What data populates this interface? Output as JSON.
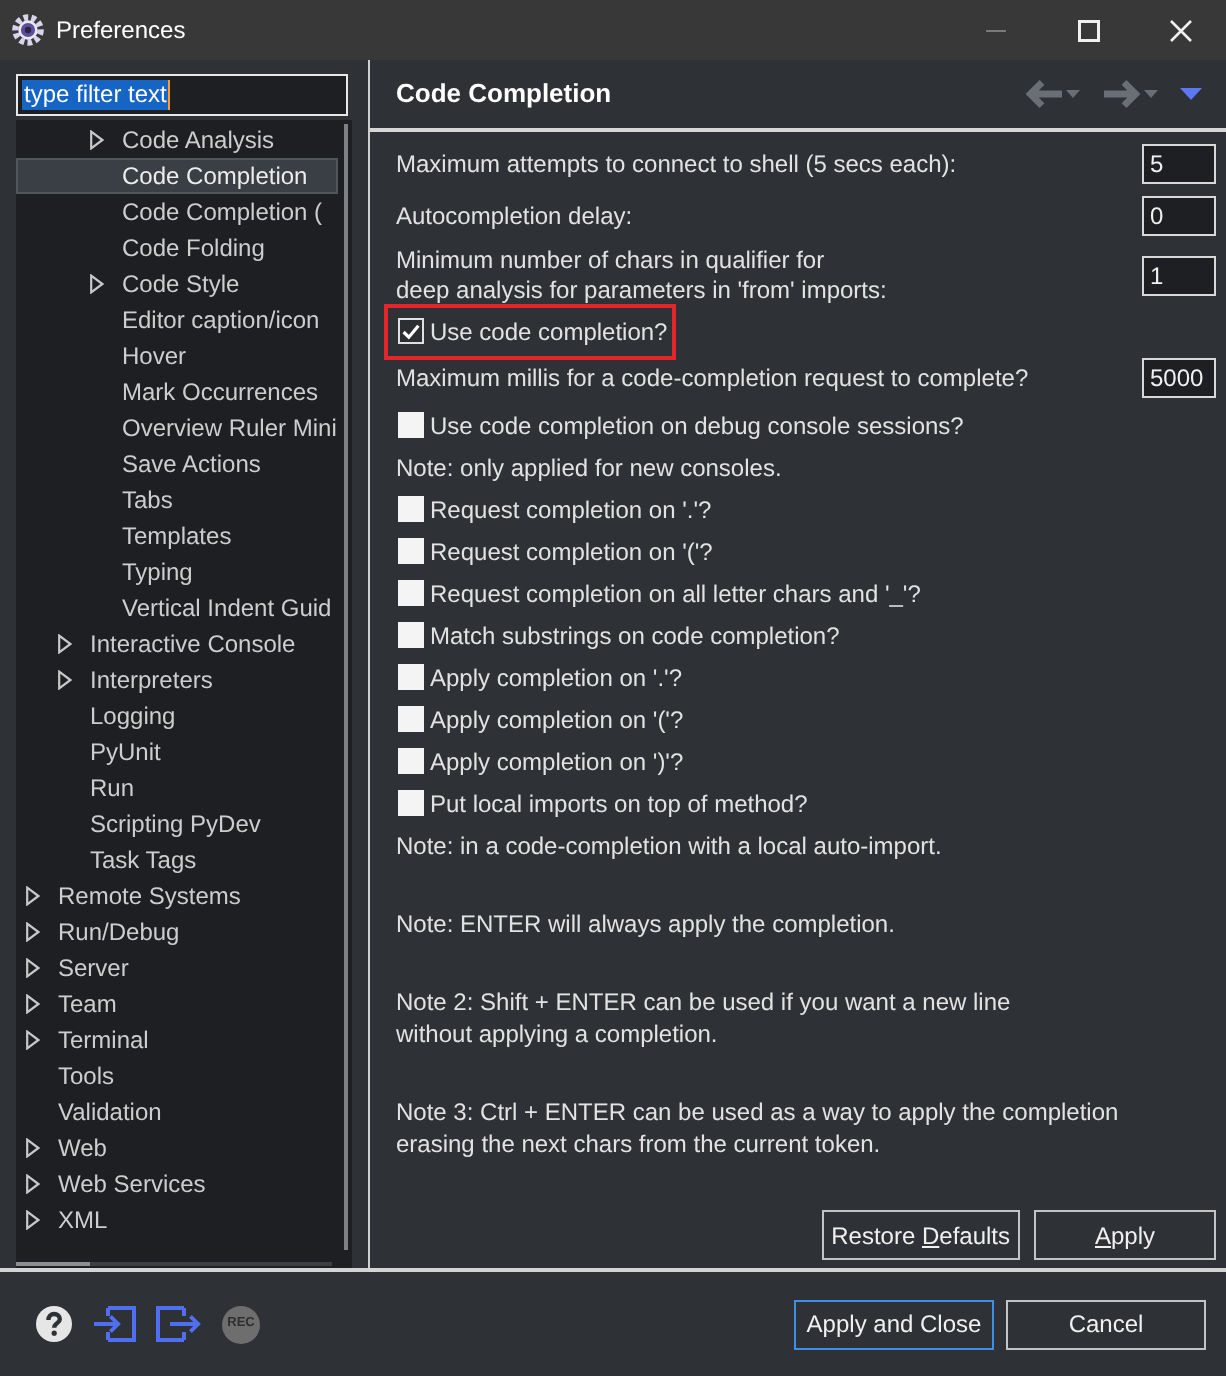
{
  "window": {
    "title": "Preferences",
    "controls": [
      {
        "kind": "minimize",
        "disabled": true
      },
      {
        "kind": "maximize",
        "disabled": false
      },
      {
        "kind": "close",
        "disabled": false
      }
    ]
  },
  "filter": {
    "value": "type filter text",
    "value_selected": true
  },
  "tree": [
    {
      "children": [
        {
          "children": [
            {
              "label": "Code Analysis",
              "kind": "branch",
              "selected": false
            },
            {
              "label": "Code Completion",
              "kind": "leaf",
              "selected": true
            },
            {
              "label": "Code Completion (",
              "kind": "leaf",
              "selected": false
            },
            {
              "label": "Code Folding",
              "kind": "leaf",
              "selected": false
            },
            {
              "label": "Code Style",
              "kind": "branch",
              "selected": false
            },
            {
              "label": "Editor caption/icon",
              "kind": "leaf",
              "selected": false
            },
            {
              "label": "Hover",
              "kind": "leaf",
              "selected": false
            },
            {
              "label": "Mark Occurrences",
              "kind": "leaf",
              "selected": false
            },
            {
              "label": "Overview Ruler Mini",
              "kind": "leaf",
              "selected": false
            },
            {
              "label": "Save Actions",
              "kind": "leaf",
              "selected": false
            },
            {
              "label": "Tabs",
              "kind": "leaf",
              "selected": false
            },
            {
              "label": "Templates",
              "kind": "leaf",
              "selected": false
            },
            {
              "label": "Typing",
              "kind": "leaf",
              "selected": false
            },
            {
              "label": "Vertical Indent Guid",
              "kind": "leaf",
              "selected": false
            }
          ]
        },
        {
          "label": "Interactive Console",
          "kind": "branch",
          "selected": false
        },
        {
          "label": "Interpreters",
          "kind": "branch",
          "selected": false
        },
        {
          "label": "Logging",
          "kind": "leaf",
          "selected": false
        },
        {
          "label": "PyUnit",
          "kind": "leaf",
          "selected": false
        },
        {
          "label": "Run",
          "kind": "leaf",
          "selected": false
        },
        {
          "label": "Scripting PyDev",
          "kind": "leaf",
          "selected": false
        },
        {
          "label": "Task Tags",
          "kind": "leaf",
          "selected": false
        }
      ]
    },
    {
      "label": "Remote Systems",
      "kind": "branch",
      "selected": false
    },
    {
      "label": "Run/Debug",
      "kind": "branch",
      "selected": false
    },
    {
      "label": "Server",
      "kind": "branch",
      "selected": false
    },
    {
      "label": "Team",
      "kind": "branch",
      "selected": false
    },
    {
      "label": "Terminal",
      "kind": "branch",
      "selected": false
    },
    {
      "label": "Tools",
      "kind": "leaf",
      "selected": false
    },
    {
      "label": "Validation",
      "kind": "leaf",
      "selected": false
    },
    {
      "label": "Web",
      "kind": "branch",
      "selected": false
    },
    {
      "label": "Web Services",
      "kind": "branch",
      "selected": false
    },
    {
      "label": "XML",
      "kind": "branch",
      "selected": false
    }
  ],
  "page": {
    "title": "Code Completion",
    "nav": [
      {
        "kind": "back",
        "disabled": true
      },
      {
        "kind": "forward",
        "disabled": true
      },
      {
        "kind": "menu",
        "disabled": false
      }
    ]
  },
  "settings": [
    {
      "kind": "number",
      "label": "Maximum attempts to connect to shell (5 secs each):",
      "value": "5"
    },
    {
      "kind": "number",
      "label": "Autocompletion delay:",
      "value": "0"
    },
    {
      "kind": "number",
      "label": "Minimum number of chars in qualifier for\ndeep analysis for parameters in 'from' imports:",
      "value": "1"
    },
    {
      "kind": "checkbox",
      "label": "Use code completion?",
      "checked": true,
      "highlighted": true
    },
    {
      "kind": "number",
      "label": "Maximum millis for a code-completion request to complete?",
      "value": "5000"
    },
    {
      "kind": "checkbox",
      "label": "Use code completion on debug console sessions?",
      "checked": false,
      "highlighted": false
    },
    {
      "kind": "note",
      "text": "Note: only applied for new consoles."
    },
    {
      "kind": "checkbox",
      "label": "Request completion on '.'?",
      "checked": false,
      "highlighted": false
    },
    {
      "kind": "checkbox",
      "label": "Request completion on '('?",
      "checked": false,
      "highlighted": false
    },
    {
      "kind": "checkbox",
      "label": "Request completion on all letter chars and '_'?",
      "checked": false,
      "highlighted": false
    },
    {
      "kind": "checkbox",
      "label": "Match substrings on code completion?",
      "checked": false,
      "highlighted": false
    },
    {
      "kind": "checkbox",
      "label": "Apply completion on '.'?",
      "checked": false,
      "highlighted": false
    },
    {
      "kind": "checkbox",
      "label": "Apply completion on '('?",
      "checked": false,
      "highlighted": false
    },
    {
      "kind": "checkbox",
      "label": "Apply completion on ')'?",
      "checked": false,
      "highlighted": false
    },
    {
      "kind": "checkbox",
      "label": "Put local imports on top of method?",
      "checked": false,
      "highlighted": false
    },
    {
      "kind": "note",
      "text": "Note: in a code-completion with a local auto-import."
    },
    {
      "kind": "note",
      "text": "Note: ENTER will always apply the completion."
    },
    {
      "kind": "note",
      "text": "Note 2: Shift + ENTER can be used if you want a new line\nwithout applying a completion."
    },
    {
      "kind": "note",
      "text": "Note 3: Ctrl + ENTER can be used as a way to apply the completion\nerasing the next chars from the current token."
    }
  ],
  "page_buttons": [
    {
      "before": "Restore ",
      "key": "D",
      "after": "efaults"
    },
    {
      "key": "A",
      "after": "pply"
    }
  ],
  "footer": {
    "icons": [
      {
        "kind": "help",
        "disabled": false
      },
      {
        "kind": "import",
        "disabled": false
      },
      {
        "kind": "export",
        "disabled": false
      },
      {
        "kind": "record",
        "label": "REC",
        "disabled": true
      }
    ],
    "buttons": [
      {
        "label": "Apply and Close",
        "focused": true
      },
      {
        "label": "Cancel",
        "focused": false
      }
    ]
  }
}
